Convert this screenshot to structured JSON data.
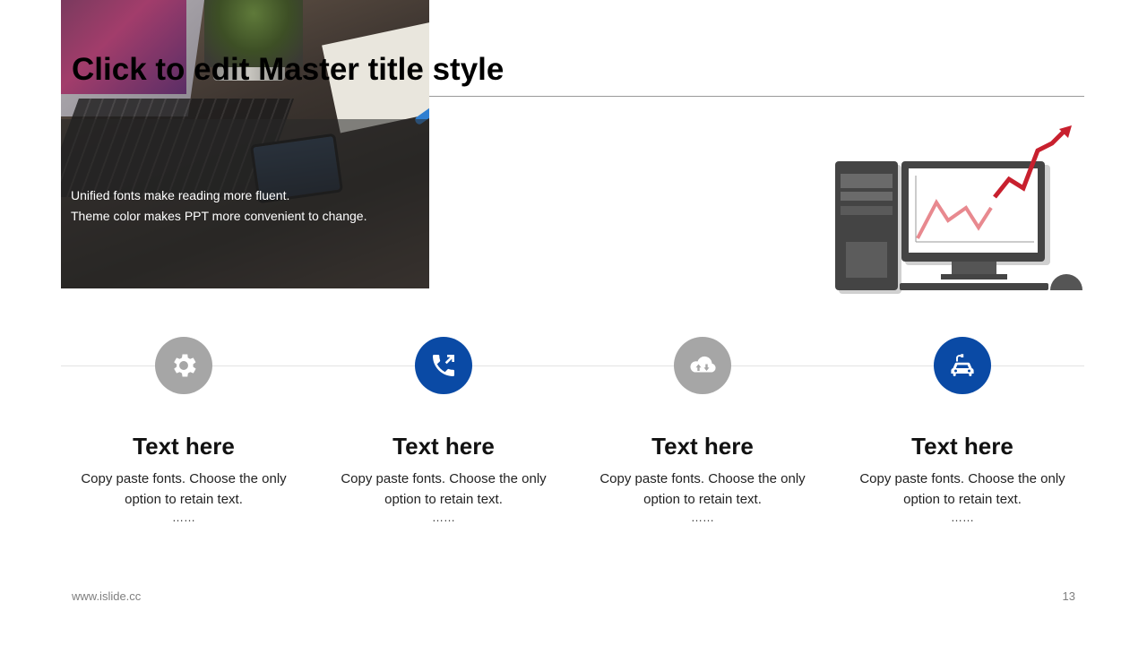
{
  "slide": {
    "title": "Click to edit Master title style",
    "caption_line1": "Unified fonts make reading  more fluent.",
    "caption_line2": "Theme color makes PPT more convenient  to change."
  },
  "colors": {
    "accent_blue": "#0a4aa5",
    "icon_gray": "#a6a6a6",
    "trend_red": "#c8202e"
  },
  "steps": [
    {
      "icon": "gear-icon",
      "color": "gray",
      "heading": "Text here",
      "line1": "Copy paste fonts. Choose the only",
      "line2": "option to retain text.",
      "ellipsis": "……"
    },
    {
      "icon": "phone-call-icon",
      "color": "blue",
      "heading": "Text here",
      "line1": "Copy paste fonts. Choose the only",
      "line2": "option to retain text.",
      "ellipsis": "……"
    },
    {
      "icon": "cloud-upload-download-icon",
      "color": "gray",
      "heading": "Text here",
      "line1": "Copy paste fonts. Choose the only",
      "line2": "option to retain text.",
      "ellipsis": "……"
    },
    {
      "icon": "electric-car-icon",
      "color": "blue",
      "heading": "Text here",
      "line1": "Copy paste fonts. Choose the only",
      "line2": "option to retain text.",
      "ellipsis": "……"
    }
  ],
  "footer": {
    "website": "www.islide.cc",
    "page_number": "13"
  }
}
